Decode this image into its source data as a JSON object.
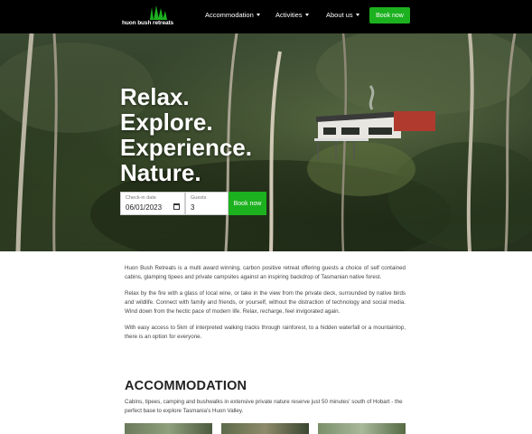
{
  "nav": {
    "logo_text": "huon bush retreats",
    "items": [
      {
        "label": "Accommodation"
      },
      {
        "label": "Activities"
      },
      {
        "label": "About us"
      }
    ],
    "book_label": "Book now"
  },
  "hero": {
    "title_lines": [
      "Relax.",
      "Explore.",
      "Experience.",
      "Nature."
    ],
    "checkin_label": "Check-in date",
    "checkin_value": "06/01/2023",
    "guests_label": "Guests",
    "guests_value": "3",
    "book_label": "Book now"
  },
  "intro": [
    "Huon Bush Retreats is a multi award winning, carbon positive retreat offering guests a choice of self contained cabins, glamping tipees and private campsites against an inspiring backdrop of Tasmanian native forest.",
    "Relax by the fire with a glass of local wine, or take in the view from the private deck, surrounded by native birds and wildlife. Connect with family and friends, or yourself, without the distraction of technology and social media. Wind down from the hectic pace of modern life. Relax, recharge, feel invigorated again.",
    "With easy access to 5km of interpreted walking tracks through rainforest, to a hidden waterfall or a mountaintop, there is an option for everyone."
  ],
  "accommodation": {
    "heading": "ACCOMMODATION",
    "subtitle": "Cabins, tipees, camping and bushwalks in extensive private nature reserve just 50 minutes' south of Hobart - the perfect base to explore Tasmania's Huon Valley."
  },
  "colors": {
    "nav_bg": "#000000",
    "accent_green": "#1cb11f"
  }
}
